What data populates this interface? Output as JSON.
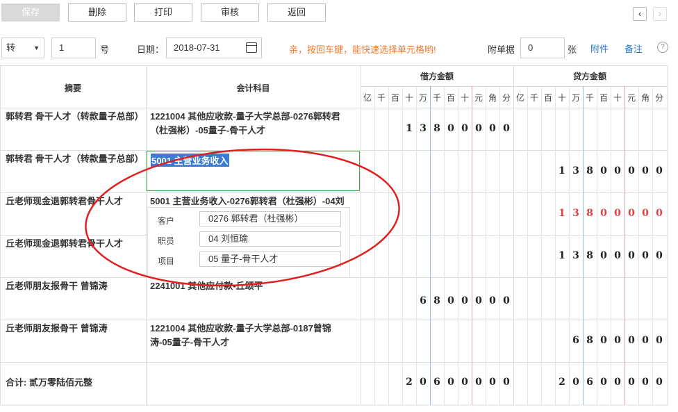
{
  "toolbar": {
    "save": "保存",
    "delete": "删除",
    "print": "打印",
    "audit": "审核",
    "back": "返回"
  },
  "nav": {
    "prev": "‹",
    "next": "›"
  },
  "form": {
    "voucher_type": "转",
    "voucher_no": "1",
    "no_suffix": "号",
    "date_label": "日期：",
    "date": "2018-07-31",
    "hint": "亲，按回车键，能快速选择单元格哟!",
    "attach_label": "附单据",
    "attach_count": "0",
    "attach_unit": "张",
    "attach_link": "附件",
    "note_link": "备注",
    "help": "?"
  },
  "table": {
    "col_summary": "摘要",
    "col_account": "会计科目",
    "col_debit": "借方金额",
    "col_credit": "贷方金额",
    "units": [
      "亿",
      "千",
      "百",
      "十",
      "万",
      "千",
      "百",
      "十",
      "元",
      "角",
      "分"
    ],
    "rows": [
      {
        "summary": "郭转君 骨干人才（转款量子总部）",
        "account_1": "1221004 其他应收款-量子大学总部-0276郭转君",
        "account_2": "（杜强彬）-05量子-骨干人才",
        "debit": "13800000",
        "credit": ""
      },
      {
        "summary": "郭转君 骨干人才（转款量子总部）",
        "account_1": "5001 主营业务收入",
        "account_2": "",
        "debit": "",
        "credit": "13800000"
      },
      {
        "summary": "丘老师现金退郭转君骨干人才",
        "account_1": "5001 主营业务收入-0276郭转君（杜强彬）-04刘",
        "account_2": "",
        "debit": "",
        "credit": "13800000"
      },
      {
        "summary": "丘老师现金退郭转君骨干人才",
        "account_1": "",
        "account_2": "",
        "debit": "",
        "credit": "13800000"
      },
      {
        "summary": "丘老师朋友报骨干 曾锦涛",
        "account_1": "2241001 其他应付款-丘颂平",
        "account_2": "",
        "debit": "6800000",
        "credit": ""
      },
      {
        "summary": "丘老师朋友报骨干 曾锦涛",
        "account_1": "1221004 其他应收款-量子大学总部-0187曾锦",
        "account_2": "涛-05量子-骨干人才",
        "debit": "",
        "credit": "6800000"
      }
    ],
    "total_label": "合计: 贰万零陆佰元整",
    "total_debit": "20600000",
    "total_credit": "20600000"
  },
  "popup": {
    "customer_label": "客户",
    "customer": "0276 郭转君（杜强彬）",
    "staff_label": "职员",
    "staff": "04 刘恒瑜",
    "project_label": "项目",
    "project": "05 量子-骨干人才"
  },
  "colors": {
    "accent_blue": "#2a78d4",
    "hint_orange": "#f07a2a",
    "annotation_red": "#e02020",
    "selection_blue": "#3a7bd5",
    "active_border_green": "#3cb043"
  }
}
